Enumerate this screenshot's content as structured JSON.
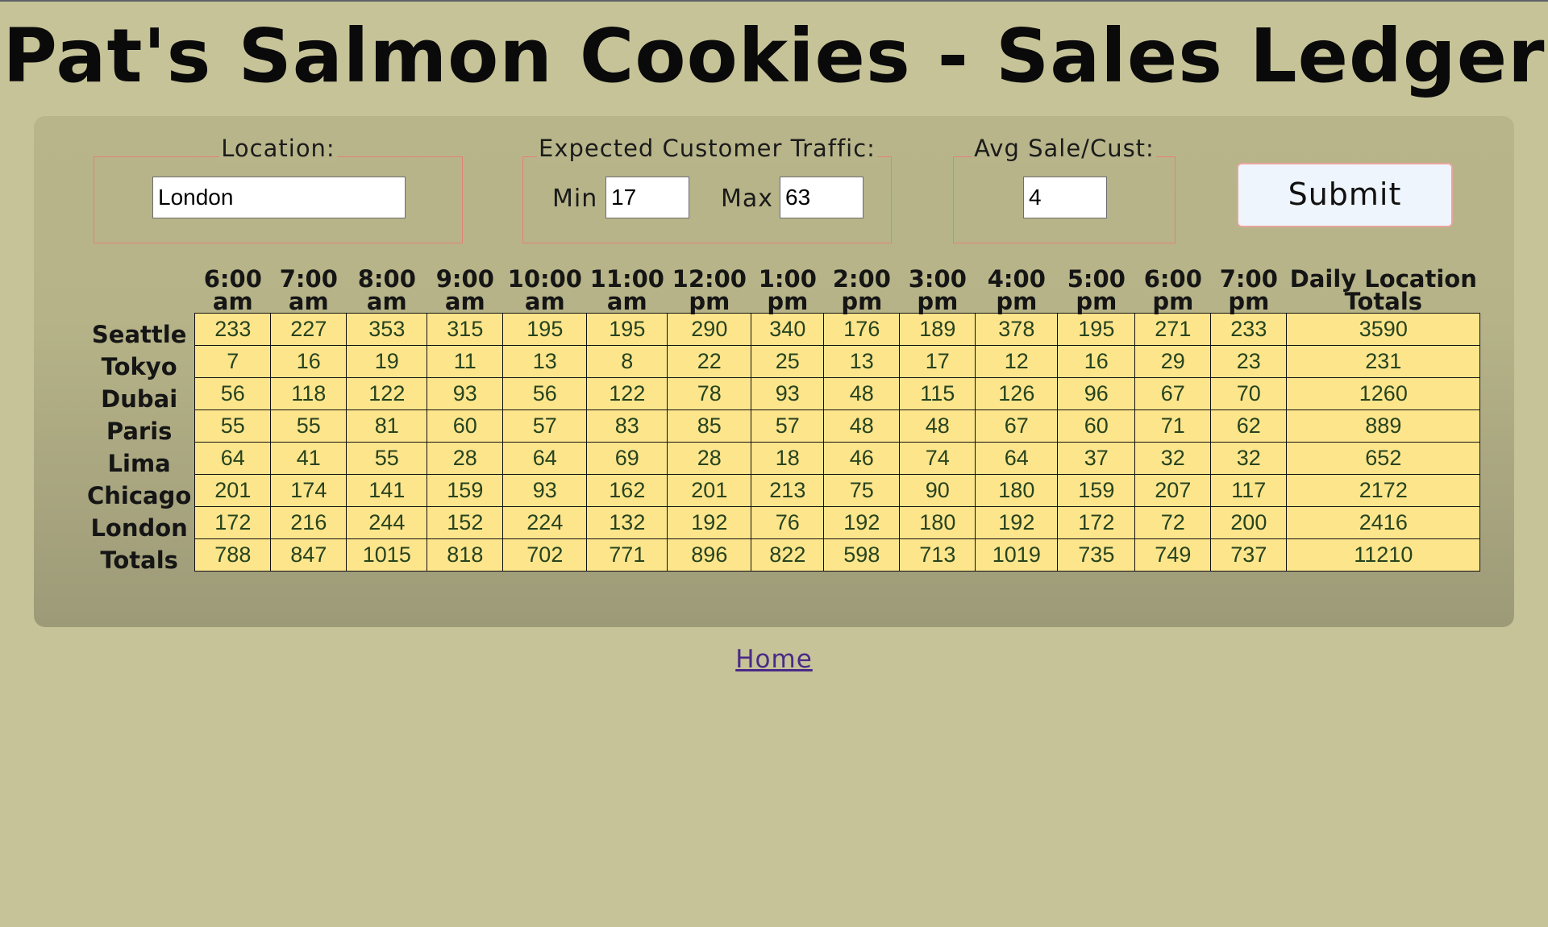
{
  "page": {
    "title": "Pat's Salmon Cookies - Sales Ledger",
    "home_link": "Home"
  },
  "form": {
    "location": {
      "legend": "Location:",
      "value": "London"
    },
    "traffic": {
      "legend": "Expected Customer Traffic:",
      "min_label": "Min",
      "min_value": "17",
      "max_label": "Max",
      "max_value": "63"
    },
    "avg_sale": {
      "legend": "Avg Sale/Cust:",
      "value": "4"
    },
    "submit_label": "Submit"
  },
  "table": {
    "hours": [
      [
        "6:00",
        "am"
      ],
      [
        "7:00",
        "am"
      ],
      [
        "8:00",
        "am"
      ],
      [
        "9:00",
        "am"
      ],
      [
        "10:00",
        "am"
      ],
      [
        "11:00",
        "am"
      ],
      [
        "12:00",
        "pm"
      ],
      [
        "1:00",
        "pm"
      ],
      [
        "2:00",
        "pm"
      ],
      [
        "3:00",
        "pm"
      ],
      [
        "4:00",
        "pm"
      ],
      [
        "5:00",
        "pm"
      ],
      [
        "6:00",
        "pm"
      ],
      [
        "7:00",
        "pm"
      ]
    ],
    "total_header": [
      "Daily Location",
      "Totals"
    ],
    "rows": [
      {
        "location": "Seattle",
        "values": [
          233,
          227,
          353,
          315,
          195,
          195,
          290,
          340,
          176,
          189,
          378,
          195,
          271,
          233
        ],
        "total": 3590
      },
      {
        "location": "Tokyo",
        "values": [
          7,
          16,
          19,
          11,
          13,
          8,
          22,
          25,
          13,
          17,
          12,
          16,
          29,
          23
        ],
        "total": 231
      },
      {
        "location": "Dubai",
        "values": [
          56,
          118,
          122,
          93,
          56,
          122,
          78,
          93,
          48,
          115,
          126,
          96,
          67,
          70
        ],
        "total": 1260
      },
      {
        "location": "Paris",
        "values": [
          55,
          55,
          81,
          60,
          57,
          83,
          85,
          57,
          48,
          48,
          67,
          60,
          71,
          62
        ],
        "total": 889
      },
      {
        "location": "Lima",
        "values": [
          64,
          41,
          55,
          28,
          64,
          69,
          28,
          18,
          46,
          74,
          64,
          37,
          32,
          32
        ],
        "total": 652
      },
      {
        "location": "Chicago",
        "values": [
          201,
          174,
          141,
          159,
          93,
          162,
          201,
          213,
          75,
          90,
          180,
          159,
          207,
          117
        ],
        "total": 2172
      },
      {
        "location": "London",
        "values": [
          172,
          216,
          244,
          152,
          224,
          132,
          192,
          76,
          192,
          180,
          192,
          172,
          72,
          200
        ],
        "total": 2416
      }
    ],
    "totals_row": {
      "label": "Totals",
      "values": [
        788,
        847,
        1015,
        818,
        702,
        771,
        896,
        822,
        598,
        713,
        1019,
        735,
        749,
        737
      ],
      "total": 11210
    }
  }
}
